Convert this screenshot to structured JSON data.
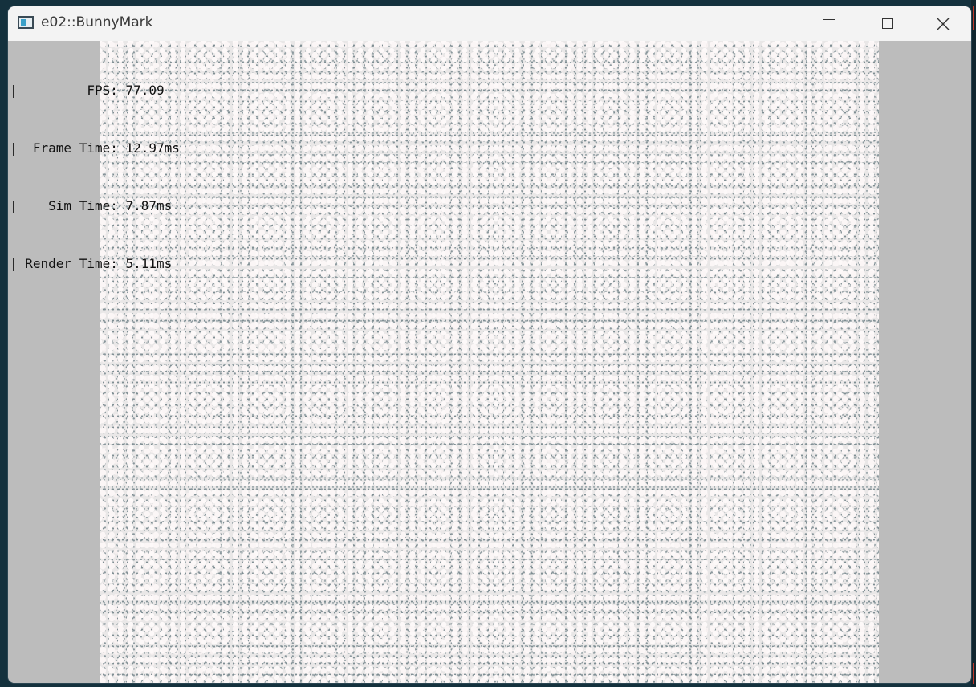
{
  "window": {
    "title": "e02::BunnyMark"
  },
  "controls": {
    "minimize": "minimize",
    "maximize": "maximize",
    "close": "close"
  },
  "hud": {
    "rows": [
      "|         FPS: 77.09",
      "|  Frame Time: 12.97ms",
      "|    Sim Time: 7.87ms",
      "| Render Time: 5.11ms"
    ]
  },
  "colors": {
    "titlebar": "#f3f3f3",
    "client_bg": "#bcbcbc",
    "bunny_fill": "#fbf6f6",
    "bunny_outline": "#7f8e93"
  }
}
